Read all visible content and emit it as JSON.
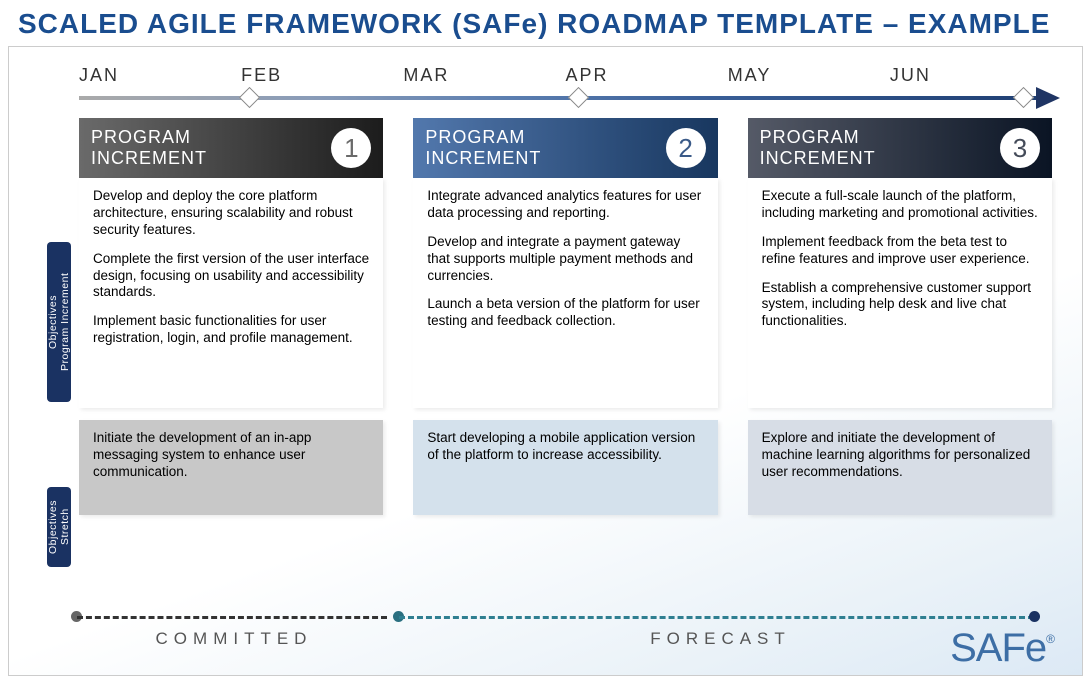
{
  "title": "SCALED AGILE FRAMEWORK (SAFe) ROADMAP TEMPLATE – EXAMPLE",
  "months": [
    "JAN",
    "FEB",
    "MAR",
    "APR",
    "MAY",
    "JUN"
  ],
  "sideLabels": {
    "objectives": "Program Increment Objectives",
    "stretch": "Stretch Objectives"
  },
  "increments": [
    {
      "label": "PROGRAM INCREMENT",
      "num": "1",
      "objectives": [
        "Develop and deploy the core platform architecture, ensuring scalability and robust security features.",
        "Complete the first version of the user interface design, focusing on usability and accessibility standards.",
        "Implement basic functionalities for user registration, login, and profile management."
      ],
      "stretch": "Initiate the development of an in-app messaging system to enhance user communication."
    },
    {
      "label": "PROGRAM INCREMENT",
      "num": "2",
      "objectives": [
        "Integrate advanced analytics features for user data processing and reporting.",
        "Develop and integrate a payment gateway that supports multiple payment methods and currencies.",
        "Launch a beta version of the platform for user testing and feedback collection."
      ],
      "stretch": "Start developing a mobile application version of the platform to increase accessibility."
    },
    {
      "label": "PROGRAM INCREMENT",
      "num": "3",
      "objectives": [
        "Execute a full-scale launch of the platform, including marketing and promotional activities.",
        "Implement feedback from the beta test to refine features and improve user experience.",
        "Establish a comprehensive customer support system, including help desk and live chat functionalities."
      ],
      "stretch": "Explore and initiate the development of machine learning algorithms for personalized user recommendations."
    }
  ],
  "status": {
    "committed": "COMMITTED",
    "forecast": "FORECAST"
  },
  "logo": "SAFe"
}
